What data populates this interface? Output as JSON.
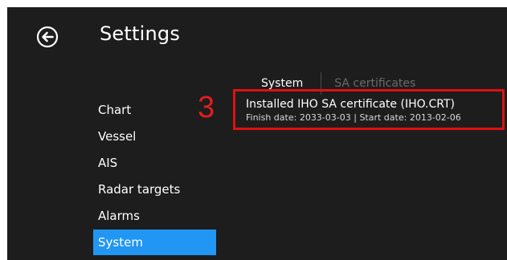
{
  "header": {
    "back_icon": "back-arrow-circle-icon",
    "title": "Settings"
  },
  "sidebar": {
    "items": [
      {
        "label": "Chart"
      },
      {
        "label": "Vessel"
      },
      {
        "label": "AIS"
      },
      {
        "label": "Radar targets"
      },
      {
        "label": "Alarms"
      },
      {
        "label": "System",
        "active": true
      }
    ]
  },
  "tabs": [
    {
      "label": "System",
      "active": true
    },
    {
      "label": "SA certificates",
      "active": false
    }
  ],
  "annotation": {
    "step_number": "3"
  },
  "certificate": {
    "title": "Installed IHO SA certificate (IHO.CRT)",
    "dates": "Finish date: 2033-03-03 | Start date: 2013-02-06"
  },
  "colors": {
    "background": "#1d1d1d",
    "accent": "#2196f3",
    "highlight": "#e01010",
    "inactive_tab": "#6a6a6a"
  }
}
